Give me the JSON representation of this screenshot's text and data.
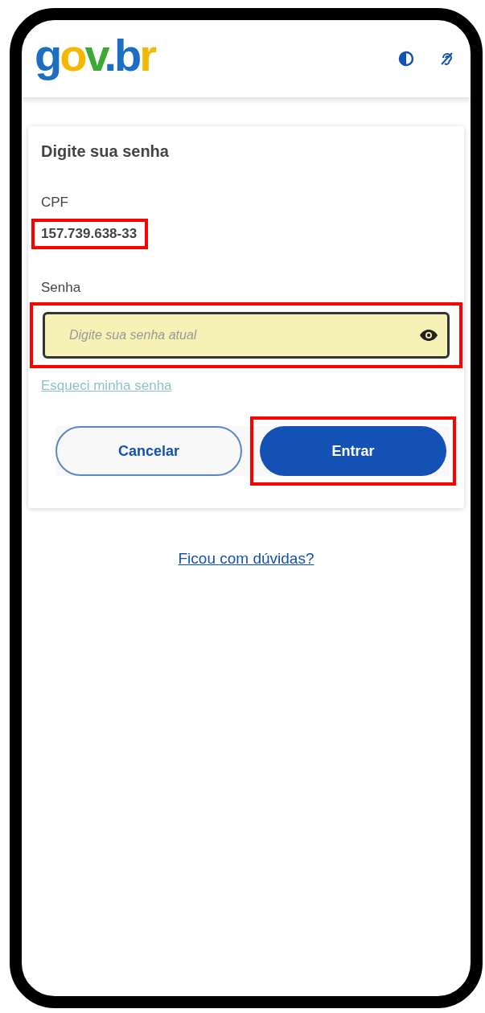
{
  "header": {
    "logo": [
      {
        "text": "g",
        "color": "#1b6ec2"
      },
      {
        "text": "o",
        "color": "#f5b800"
      },
      {
        "text": "v",
        "color": "#3aaa35"
      },
      {
        "text": ".",
        "color": "#1b6ec2"
      },
      {
        "text": "b",
        "color": "#1b6ec2"
      },
      {
        "text": "r",
        "color": "#f5b800"
      }
    ]
  },
  "card": {
    "title": "Digite sua senha",
    "cpf": {
      "label": "CPF",
      "value": "157.739.638-33",
      "highlighted": true
    },
    "password": {
      "label": "Senha",
      "placeholder": "Digite sua senha atual",
      "highlighted": true
    },
    "forgot_link": "Esqueci minha senha",
    "buttons": [
      {
        "label": "Cancelar",
        "kind": "secondary",
        "highlighted": false
      },
      {
        "label": "Entrar",
        "kind": "primary",
        "highlighted": true
      }
    ]
  },
  "help_link": "Ficou com dúvidas?"
}
